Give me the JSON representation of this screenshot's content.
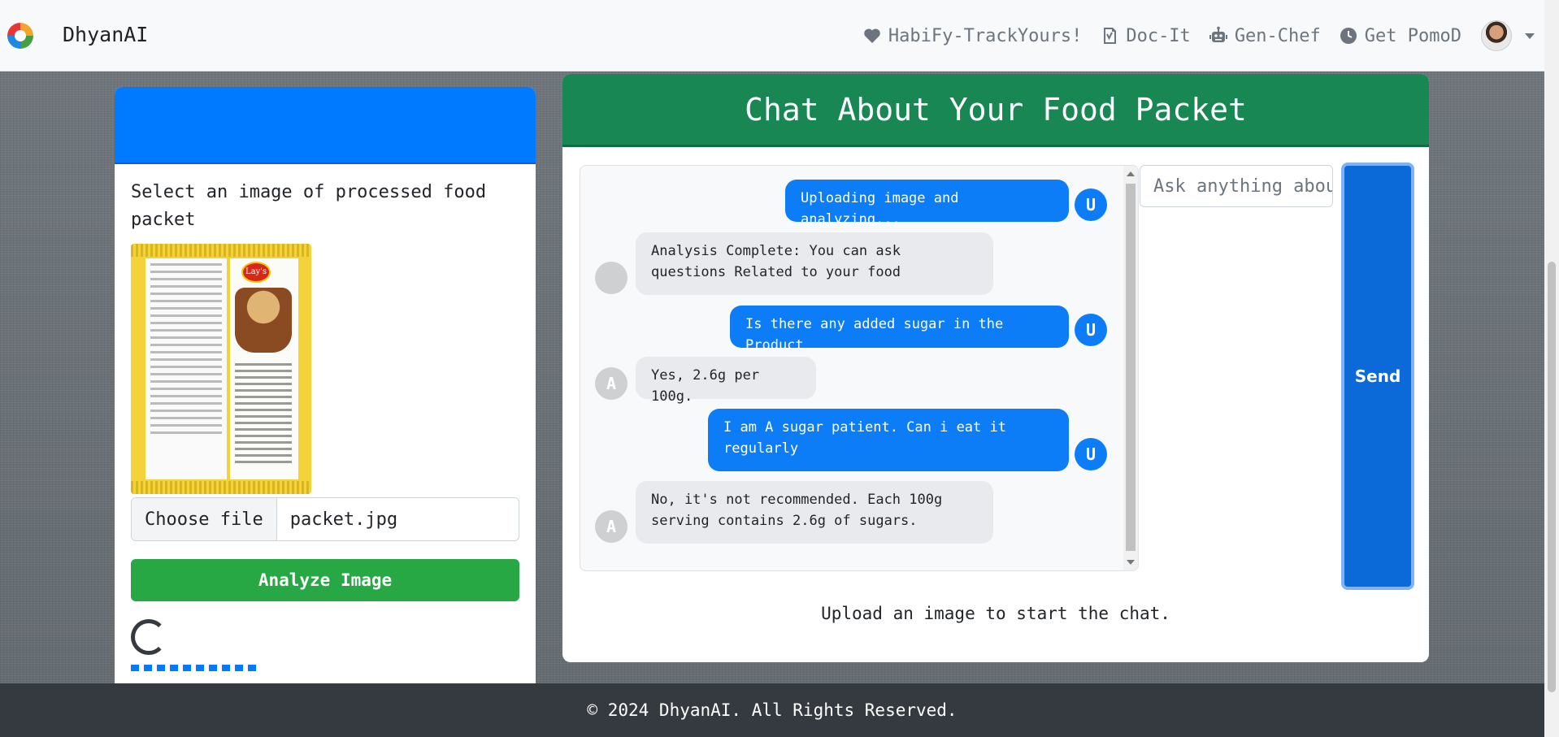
{
  "navbar": {
    "brand": "DhyanAI",
    "links": [
      {
        "label": "HabiFy-TrackYours!",
        "icon": "heart-icon"
      },
      {
        "label": "Doc-It",
        "icon": "doc-check-icon"
      },
      {
        "label": "Gen-Chef",
        "icon": "robot-icon"
      },
      {
        "label": "Get PomoD",
        "icon": "clock-icon"
      }
    ]
  },
  "upload": {
    "label": "Select an image of processed food packet",
    "choose_file": "Choose file",
    "file_name": "packet.jpg",
    "analyze_button": "Analyze Image",
    "packet_brand": "Lay's"
  },
  "chat": {
    "title": "Chat About Your Food Packet",
    "input_placeholder": "Ask anything about",
    "send_button": "Send",
    "hint": "Upload an image to start the chat.",
    "messages": [
      {
        "role": "user",
        "avatar": "U",
        "text": "Uploading image and analyzing..."
      },
      {
        "role": "bot",
        "avatar": "",
        "text": "Analysis Complete: You can ask questions Related to your food"
      },
      {
        "role": "user",
        "avatar": "U",
        "text": "Is there any added sugar in the Product"
      },
      {
        "role": "bot",
        "avatar": "A",
        "text": "Yes, 2.6g per 100g."
      },
      {
        "role": "user",
        "avatar": "U",
        "text": "I am A sugar patient. Can i eat it regularly"
      },
      {
        "role": "bot",
        "avatar": "A",
        "text": "No, it's not recommended. Each 100g serving contains 2.6g of sugars."
      }
    ]
  },
  "footer": {
    "text": "© 2024 DhyanAI. All Rights Reserved."
  },
  "colors": {
    "primary": "#007bff",
    "success": "#28a745",
    "chat_header": "#198754",
    "footer": "#343a40"
  }
}
